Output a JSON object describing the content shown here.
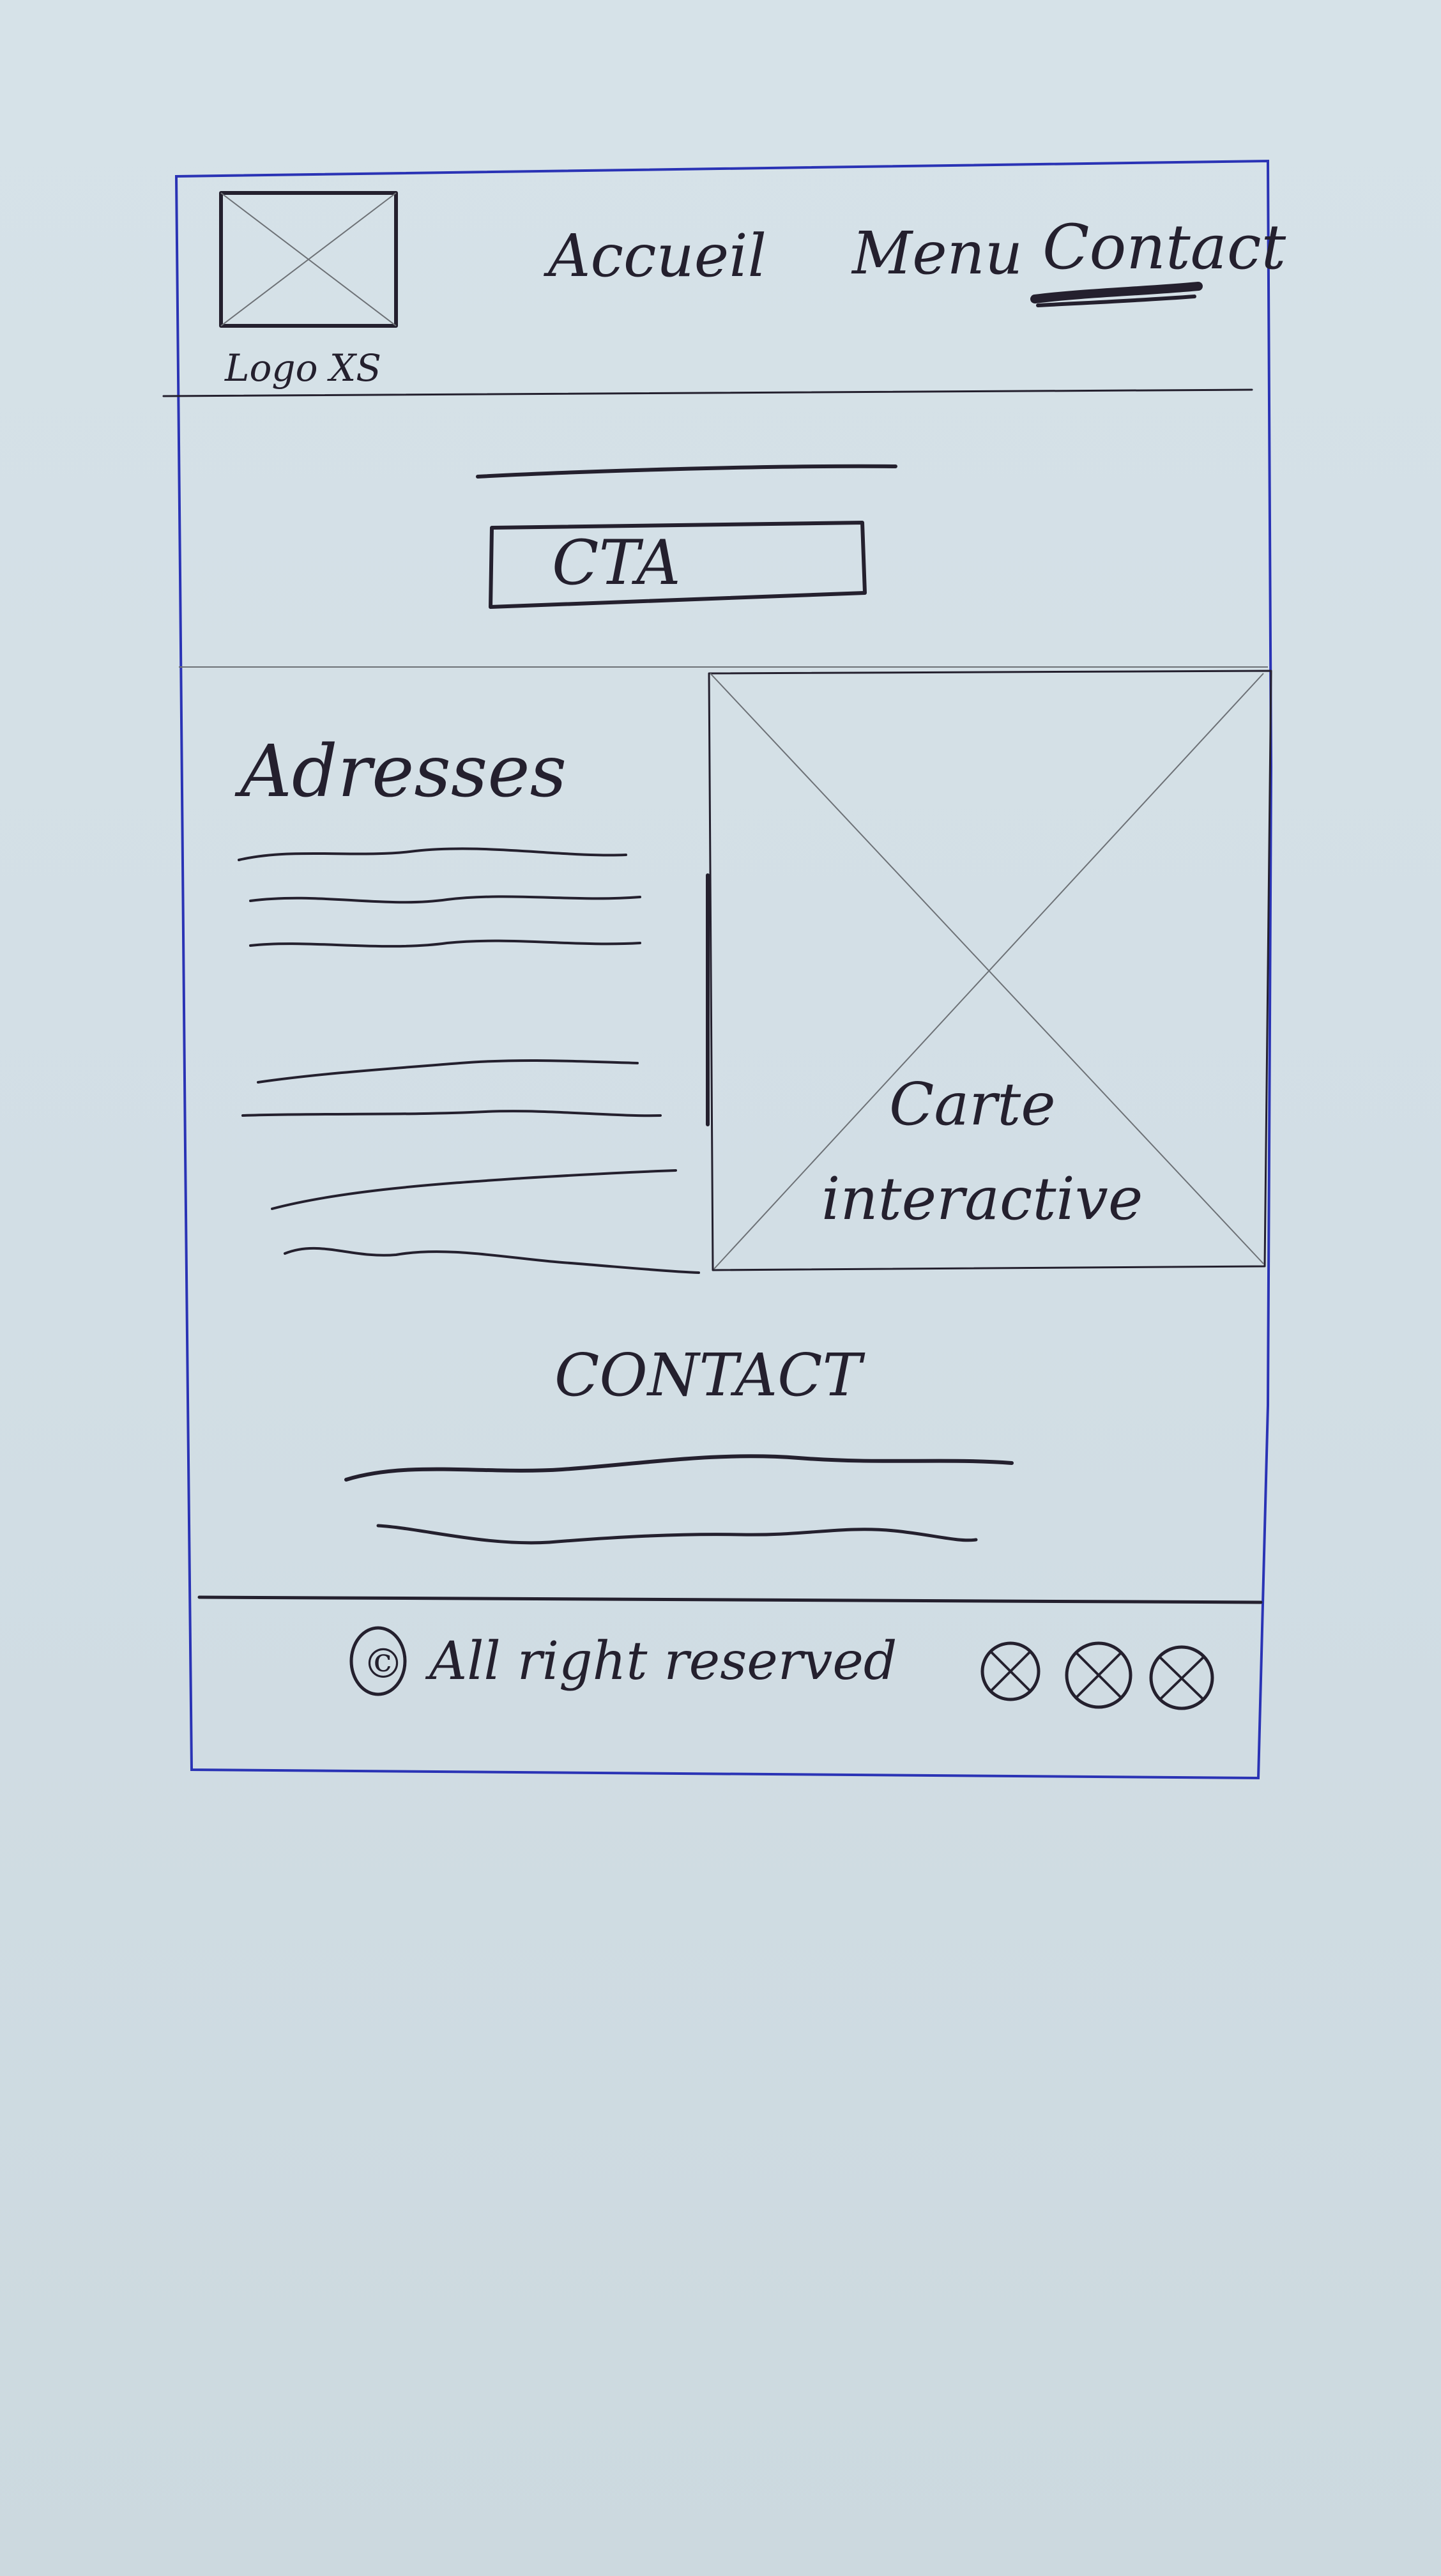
{
  "header": {
    "logo_label": "Logo XS",
    "nav": [
      {
        "label": "Accueil",
        "active": false
      },
      {
        "label": "Menu",
        "active": false
      },
      {
        "label": "Contact",
        "active": true
      }
    ]
  },
  "hero": {
    "cta_label": "CTA"
  },
  "addresses": {
    "title": "Adresses"
  },
  "map": {
    "label_line1": "Carte",
    "label_line2": "interactive"
  },
  "contact": {
    "title": "CONTACT"
  },
  "footer": {
    "copyright_symbol": "©",
    "copyright_text": "All right reserved",
    "social_icons": [
      "placeholder-icon",
      "placeholder-icon",
      "placeholder-icon"
    ]
  },
  "colors": {
    "paper": "#d3dfe6",
    "ink": "#24202e",
    "frame": "#2a33b5"
  }
}
